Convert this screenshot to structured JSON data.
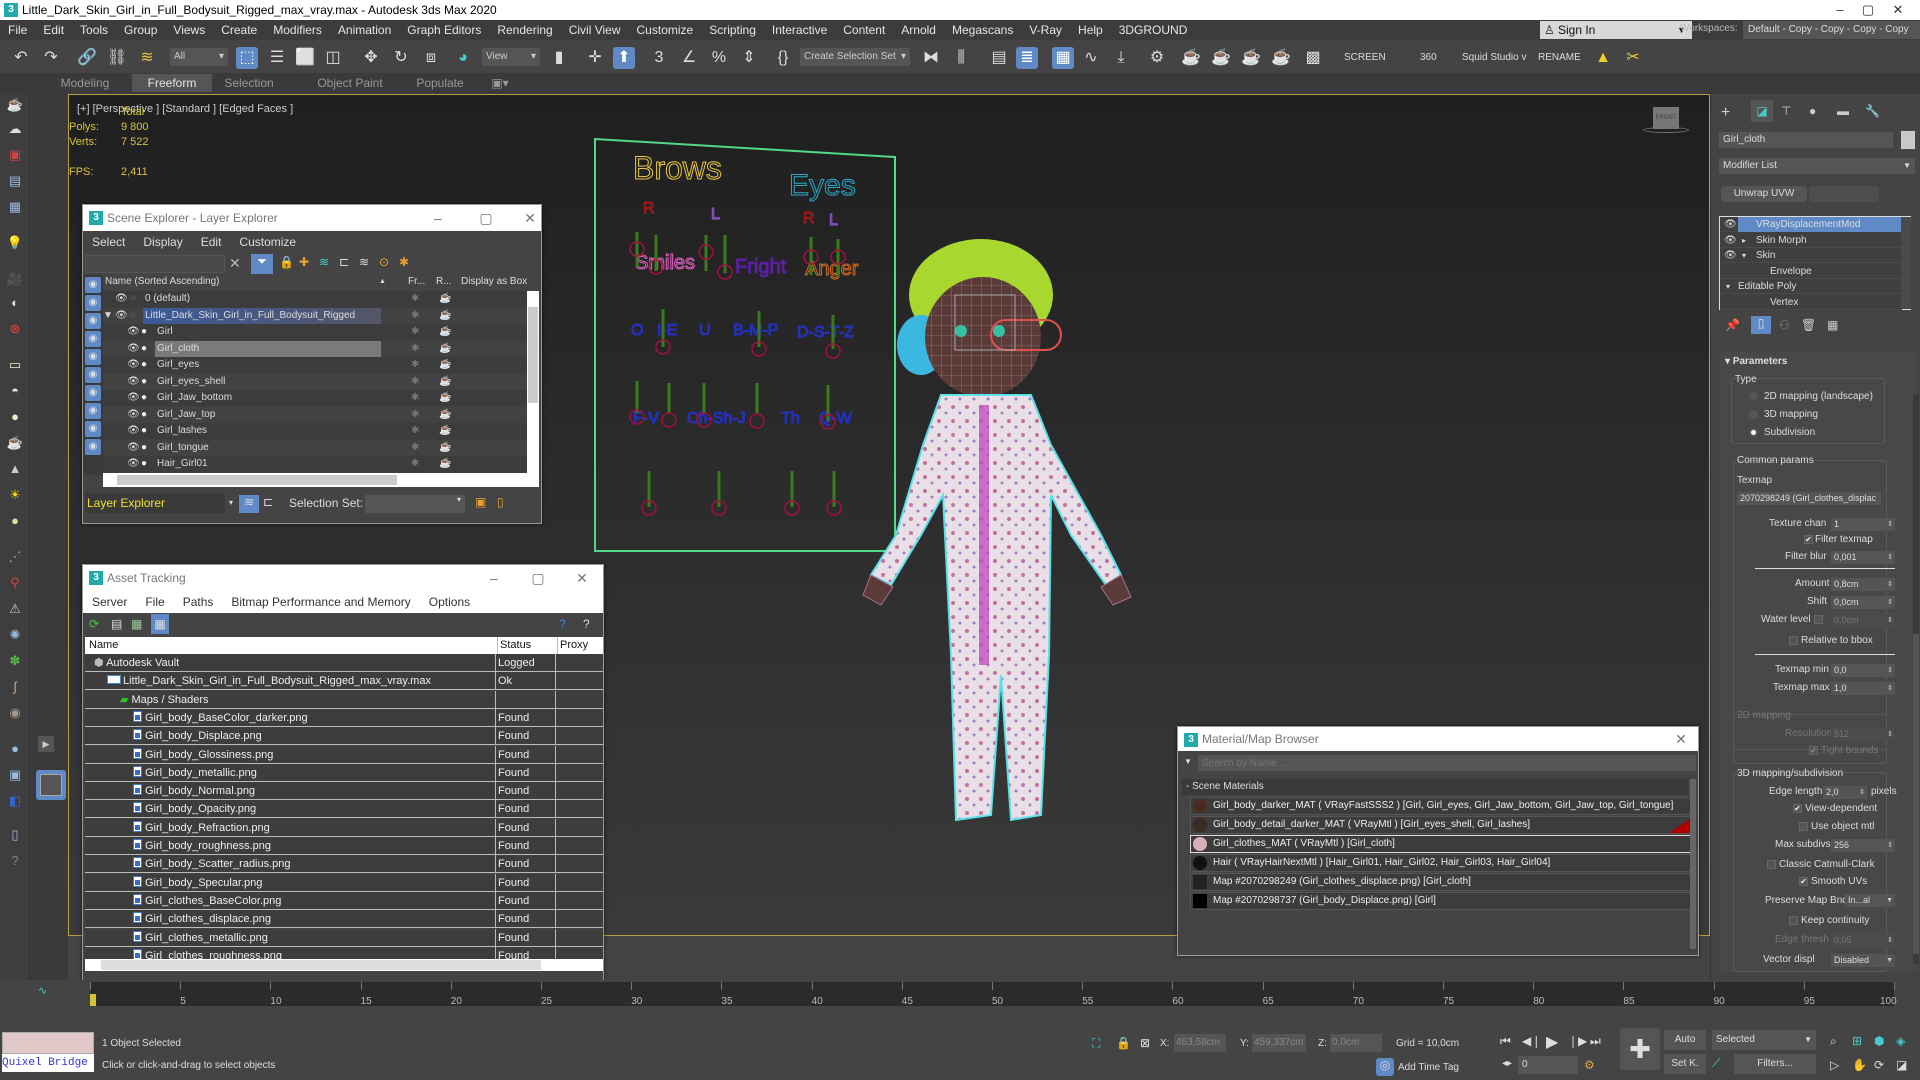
{
  "window": {
    "title": "Little_Dark_Skin_Girl_in_Full_Bodysuit_Rigged_max_vray.max - Autodesk 3ds Max 2020",
    "controls": {
      "minimize": "–",
      "maximize": "▢",
      "close": "✕"
    }
  },
  "menubar": {
    "items": [
      "File",
      "Edit",
      "Tools",
      "Group",
      "Views",
      "Create",
      "Modifiers",
      "Animation",
      "Graph Editors",
      "Rendering",
      "Civil View",
      "Customize",
      "Scripting",
      "Interactive",
      "Content",
      "Arnold",
      "Megascans",
      "V-Ray",
      "Help",
      "3DGROUND"
    ],
    "sign_in": "Sign In",
    "workspaces_label": "Workspaces:",
    "workspace_value": "Default - Copy - Copy - Copy - Copy"
  },
  "toolbar": {
    "selection_filter": "All",
    "reference_coord": "View",
    "create_selection_set": "Create Selection Set",
    "text_buttons": [
      "SCREEN",
      "360",
      "Squid Studio v",
      "RENAME"
    ]
  },
  "ribbon": {
    "tabs": [
      "Modeling",
      "Freeform",
      "Selection",
      "Object Paint",
      "Populate"
    ],
    "active_tab": "Freeform"
  },
  "viewport": {
    "label": "[+] [Perspective ] [Standard ] [Edged Faces ]",
    "stats": {
      "header": "Total",
      "polys_label": "Polys:",
      "polys": "9 800",
      "verts_label": "Verts:",
      "verts": "7 522",
      "fps_label": "FPS:",
      "fps": "2,411"
    },
    "viewcube_label": "FRONT",
    "face_rig_board": {
      "labels": [
        {
          "text": "Brows",
          "color": "#e8c840"
        },
        {
          "text": "Eyes",
          "color": "#29a8c8"
        },
        {
          "text": "R",
          "color": "#b01818"
        },
        {
          "text": "L",
          "color": "#9a5ae0"
        },
        {
          "text": "R",
          "color": "#b01818"
        },
        {
          "text": "L",
          "color": "#9a5ae0"
        },
        {
          "text": "Smiles",
          "color": "#e060c0"
        },
        {
          "text": "Fright",
          "color": "#5a20a0"
        },
        {
          "text": "Anger",
          "color": "#d06a20"
        },
        {
          "text": "O",
          "color": "#2430c0"
        },
        {
          "text": "I-E",
          "color": "#2430c0"
        },
        {
          "text": "U",
          "color": "#2430c0"
        },
        {
          "text": "B-M-P",
          "color": "#2430c0"
        },
        {
          "text": "D-S-T-Z",
          "color": "#2430c0"
        },
        {
          "text": "F-V",
          "color": "#2430c0"
        },
        {
          "text": "Ch-Sh-J",
          "color": "#2430c0"
        },
        {
          "text": "Th",
          "color": "#2430c0"
        },
        {
          "text": "Q-W",
          "color": "#2430c0"
        }
      ]
    }
  },
  "scene_explorer": {
    "title": "Scene Explorer - Layer Explorer",
    "menu": [
      "Select",
      "Display",
      "Edit",
      "Customize"
    ],
    "columns": [
      "Name (Sorted Ascending)",
      "Fr...",
      "R...",
      "Display as Box"
    ],
    "rows": [
      {
        "name": "0 (default)",
        "level": 0,
        "selected": false
      },
      {
        "name": "Little_Dark_Skin_Girl_in_Full_Bodysuit_Rigged",
        "level": 0,
        "selected": true,
        "expanded": true
      },
      {
        "name": "Girl",
        "level": 1,
        "selected": false
      },
      {
        "name": "Girl_cloth",
        "level": 1,
        "selected": true
      },
      {
        "name": "Girl_eyes",
        "level": 1,
        "selected": false
      },
      {
        "name": "Girl_eyes_shell",
        "level": 1,
        "selected": false
      },
      {
        "name": "Girl_Jaw_bottom",
        "level": 1,
        "selected": false
      },
      {
        "name": "Girl_Jaw_top",
        "level": 1,
        "selected": false
      },
      {
        "name": "Girl_lashes",
        "level": 1,
        "selected": false
      },
      {
        "name": "Girl_tongue",
        "level": 1,
        "selected": false
      },
      {
        "name": "Hair_Girl01",
        "level": 1,
        "selected": false
      }
    ],
    "explorer_type": "Layer Explorer",
    "selection_set_label": "Selection Set:",
    "selection_set_value": ""
  },
  "asset_tracking": {
    "title": "Asset Tracking",
    "menu": [
      "Server",
      "File",
      "Paths",
      "Bitmap Performance and Memory",
      "Options"
    ],
    "columns": [
      "Name",
      "Status",
      "Proxy Re"
    ],
    "rows": [
      {
        "name": "Autodesk Vault",
        "status": "Logged O...",
        "indent": 1,
        "icon": "vault"
      },
      {
        "name": "Little_Dark_Skin_Girl_in_Full_Bodysuit_Rigged_max_vray.max",
        "status": "Ok",
        "indent": 2,
        "icon": "maxfile"
      },
      {
        "name": "Maps / Shaders",
        "status": "",
        "indent": 3,
        "icon": "maps"
      },
      {
        "name": "Girl_body_BaseColor_darker.png",
        "status": "Found",
        "indent": 4,
        "icon": "file"
      },
      {
        "name": "Girl_body_Displace.png",
        "status": "Found",
        "indent": 4,
        "icon": "file"
      },
      {
        "name": "Girl_body_Glossiness.png",
        "status": "Found",
        "indent": 4,
        "icon": "file"
      },
      {
        "name": "Girl_body_metallic.png",
        "status": "Found",
        "indent": 4,
        "icon": "file"
      },
      {
        "name": "Girl_body_Normal.png",
        "status": "Found",
        "indent": 4,
        "icon": "file"
      },
      {
        "name": "Girl_body_Opacity.png",
        "status": "Found",
        "indent": 4,
        "icon": "file"
      },
      {
        "name": "Girl_body_Refraction.png",
        "status": "Found",
        "indent": 4,
        "icon": "file"
      },
      {
        "name": "Girl_body_roughness.png",
        "status": "Found",
        "indent": 4,
        "icon": "file"
      },
      {
        "name": "Girl_body_Scatter_radius.png",
        "status": "Found",
        "indent": 4,
        "icon": "file"
      },
      {
        "name": "Girl_body_Specular.png",
        "status": "Found",
        "indent": 4,
        "icon": "file"
      },
      {
        "name": "Girl_clothes_BaseColor.png",
        "status": "Found",
        "indent": 4,
        "icon": "file"
      },
      {
        "name": "Girl_clothes_displace.png",
        "status": "Found",
        "indent": 4,
        "icon": "file"
      },
      {
        "name": "Girl_clothes_metallic.png",
        "status": "Found",
        "indent": 4,
        "icon": "file"
      },
      {
        "name": "Girl_clothes_roughness.png",
        "status": "Found",
        "indent": 4,
        "icon": "file"
      }
    ]
  },
  "material_browser": {
    "title": "Material/Map Browser",
    "search_placeholder": "Search by Name ...",
    "group": "- Scene Materials",
    "items": [
      {
        "label": "Girl_body_darker_MAT  ( VRayFastSSS2 )  [Girl, Girl_eyes, Girl_Jaw_bottom, Girl_Jaw_top, Girl_tongue]",
        "swatch": "#4a2a20"
      },
      {
        "label": "Girl_body_detail_darker_MAT  ( VRayMtl )  [Girl_eyes_shell, Girl_lashes]",
        "swatch": "#3a2a25",
        "flag": "#b00000"
      },
      {
        "label": "Girl_clothes_MAT  ( VRayMtl )  [Girl_cloth]",
        "swatch": "#d8b0b8",
        "selected": true
      },
      {
        "label": "Hair  ( VRayHairNextMtl )  [Hair_Girl01, Hair_Girl02, Hair_Girl03, Hair_Girl04]",
        "swatch": "#111111"
      },
      {
        "label": "Map #2070298249 (Girl_clothes_displace.png)  [Girl_cloth]",
        "swatch": "#222222"
      },
      {
        "label": "Map #2070298737 (Girl_body_Displace.png)  [Girl]",
        "swatch": "#000000"
      }
    ]
  },
  "command_panel": {
    "object_name": "Girl_cloth",
    "object_color": "#c8c8c8",
    "modifier_list": "Modifier List",
    "unwrap_button": "Unwrap UVW",
    "stack": [
      {
        "name": "VRayDisplacementMod",
        "eye": true,
        "selected": true,
        "indent": 0
      },
      {
        "name": "Skin Morph",
        "eye": true,
        "expander": "▸",
        "indent": 0
      },
      {
        "name": "Skin",
        "eye": true,
        "expander": "▾",
        "indent": 0
      },
      {
        "name": "Envelope",
        "indent": 1
      },
      {
        "name": "Editable Poly",
        "expander": "▾",
        "indent": 0
      },
      {
        "name": "Vertex",
        "indent": 1
      }
    ],
    "rollout_title": "Parameters",
    "type_group": "Type",
    "type_options": [
      "2D mapping (landscape)",
      "3D mapping",
      "Subdivision"
    ],
    "type_selected": "Subdivision",
    "common_group": "Common params",
    "texmap_label": "Texmap",
    "texmap_value": "2070298249 (Girl_clothes_displac",
    "texture_chan_label": "Texture chan",
    "texture_chan": "1",
    "filter_texmap_label": "Filter texmap",
    "filter_texmap": true,
    "filter_blur_label": "Filter blur",
    "filter_blur": "0,001",
    "amount_label": "Amount",
    "amount": "0,8cm",
    "shift_label": "Shift",
    "shift": "0,0cm",
    "water_level_label": "Water level",
    "water_level": "0,0cm",
    "water_level_enabled": false,
    "relative_bbox_label": "Relative to bbox",
    "relative_bbox": false,
    "texmap_min_label": "Texmap min",
    "texmap_min": "0,0",
    "texmap_max_label": "Texmap max",
    "texmap_max": "1,0",
    "map2d_group": "2D mapping",
    "resolution_label": "Resolution",
    "resolution": "512",
    "tight_bounds_label": "Tight bounds",
    "tight_bounds": true,
    "map3d_group": "3D mapping/subdivision",
    "edge_length_label": "Edge length",
    "edge_length": "2,0",
    "edge_length_unit": "pixels",
    "view_dependent_label": "View-dependent",
    "view_dependent": true,
    "use_object_mtl_label": "Use object mtl",
    "use_object_mtl": false,
    "max_subdivs_label": "Max subdivs",
    "max_subdivs": "256",
    "classic_cc_label": "Classic Catmull-Clark",
    "classic_cc": false,
    "smooth_uvs_label": "Smooth UVs",
    "smooth_uvs": true,
    "preserve_map_label": "Preserve Map Bnd",
    "preserve_map": "In...al",
    "keep_continuity_label": "Keep continuity",
    "keep_continuity": false,
    "edge_thresh_label": "Edge thresh",
    "edge_thresh": "0,05",
    "vector_displ_label": "Vector displ",
    "vector_displ": "Disabled"
  },
  "timeline": {
    "current_frame": "0",
    "ticks": [
      "0",
      "5",
      "10",
      "15",
      "20",
      "25",
      "30",
      "35",
      "40",
      "45",
      "50",
      "55",
      "60",
      "65",
      "70",
      "75",
      "80",
      "85",
      "90",
      "95",
      "100"
    ]
  },
  "status": {
    "maxscript_listener": "",
    "quixel_label": "Quixel Bridge",
    "selected_text": "1 Object Selected",
    "prompt": "Click or click-and-drag to select objects",
    "x_label": "X:",
    "x": "463,58cm",
    "y_label": "Y:",
    "y": "459,337cm",
    "z_label": "Z:",
    "z": "0,0cm",
    "grid": "Grid = 10,0cm",
    "add_time_tag": "Add Time Tag",
    "frame_value": "0",
    "auto_key": "Auto",
    "set_key": "Set K.",
    "key_filter_value": "Selected",
    "filters": "Filters..."
  }
}
